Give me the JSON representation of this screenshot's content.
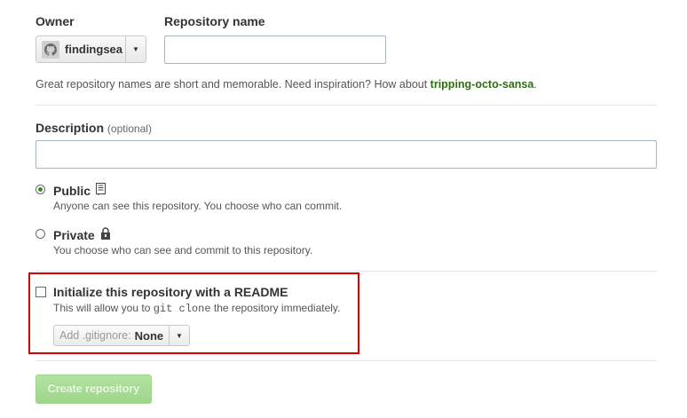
{
  "owner": {
    "label": "Owner",
    "selected": "findingsea",
    "avatar_icon": "github-octocat-icon"
  },
  "repository": {
    "label": "Repository name",
    "value": "",
    "hint_prefix": "Great repository names are short and memorable. Need inspiration? How about ",
    "hint_suggestion": "tripping-octo-sansa",
    "hint_suffix": "."
  },
  "description": {
    "label": "Description",
    "optional": "(optional)",
    "value": ""
  },
  "visibility": {
    "public": {
      "title": "Public",
      "desc": "Anyone can see this repository. You choose who can commit.",
      "checked": true,
      "icon": "repo-book-icon"
    },
    "private": {
      "title": "Private",
      "desc": "You choose who can see and commit to this repository.",
      "checked": false,
      "icon": "lock-icon"
    }
  },
  "readme": {
    "title": "Initialize this repository with a README",
    "desc_prefix": "This will allow you to ",
    "desc_code": "git clone",
    "desc_suffix": " the repository immediately.",
    "checked": false
  },
  "gitignore": {
    "prefix": "Add .gitignore:",
    "value": "None"
  },
  "create_button": {
    "label": "Create repository",
    "disabled": true
  },
  "colors": {
    "suggestion_green": "#2f6f11",
    "highlight_red": "#d90000",
    "button_green": "#9ed58a"
  }
}
